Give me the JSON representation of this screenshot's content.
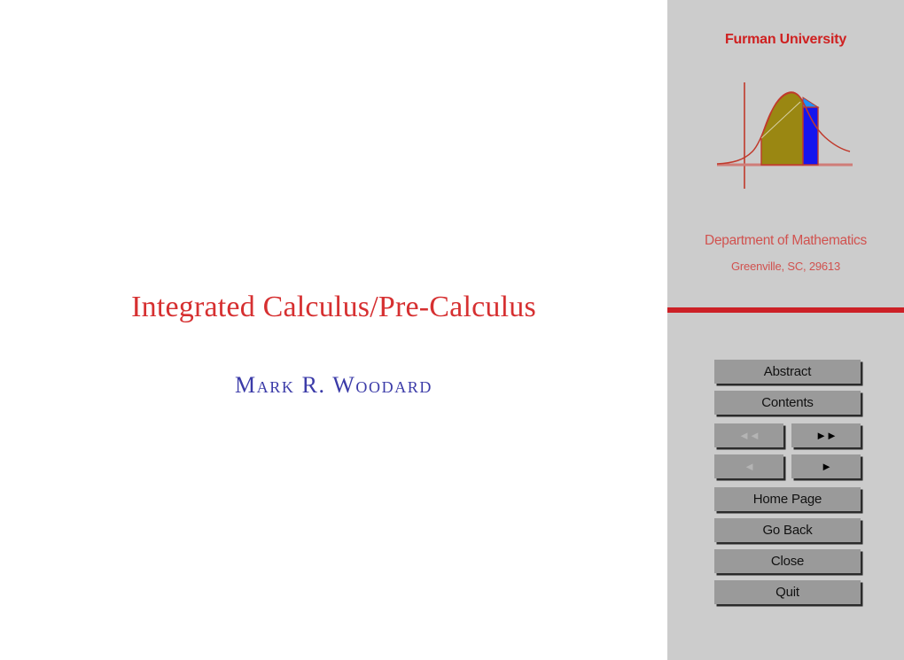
{
  "document": {
    "title": "Integrated Calculus/Pre-Calculus",
    "author": "Mark R. Woodard",
    "title_color": "#d63031",
    "author_color": "#3b3ba8",
    "background_color": "#ffffff"
  },
  "sidebar": {
    "background_color": "#cccccc",
    "accent_color": "#cc2026",
    "brand": "Furman University",
    "department": "Department of Mathematics",
    "city": "Greenville, SC, 29613",
    "logo": {
      "name": "furman-math-curve-logo",
      "curve_color": "#c0392b",
      "area_fill": "#9a8712",
      "rect_fill": "#1515ee",
      "rect_cap_fill": "#1e90ff",
      "axis_color": "#c0392b"
    },
    "divider": {
      "name": "red-rule",
      "color": "#cc2026"
    },
    "buttons": {
      "abstract": "Abstract",
      "contents": "Contents",
      "first": "◄◄",
      "last": "►►",
      "prev": "◄",
      "next": "►",
      "home_page": "Home Page",
      "go_back": "Go Back",
      "close": "Close",
      "quit": "Quit",
      "states": {
        "first": "disabled",
        "last": "enabled",
        "prev": "disabled",
        "next": "enabled"
      },
      "face_color": "#9a9a9a",
      "shadow_color": "#2b2b2b",
      "label_color": "#111111",
      "disabled_glyph_color": "#b4b4b4"
    }
  }
}
